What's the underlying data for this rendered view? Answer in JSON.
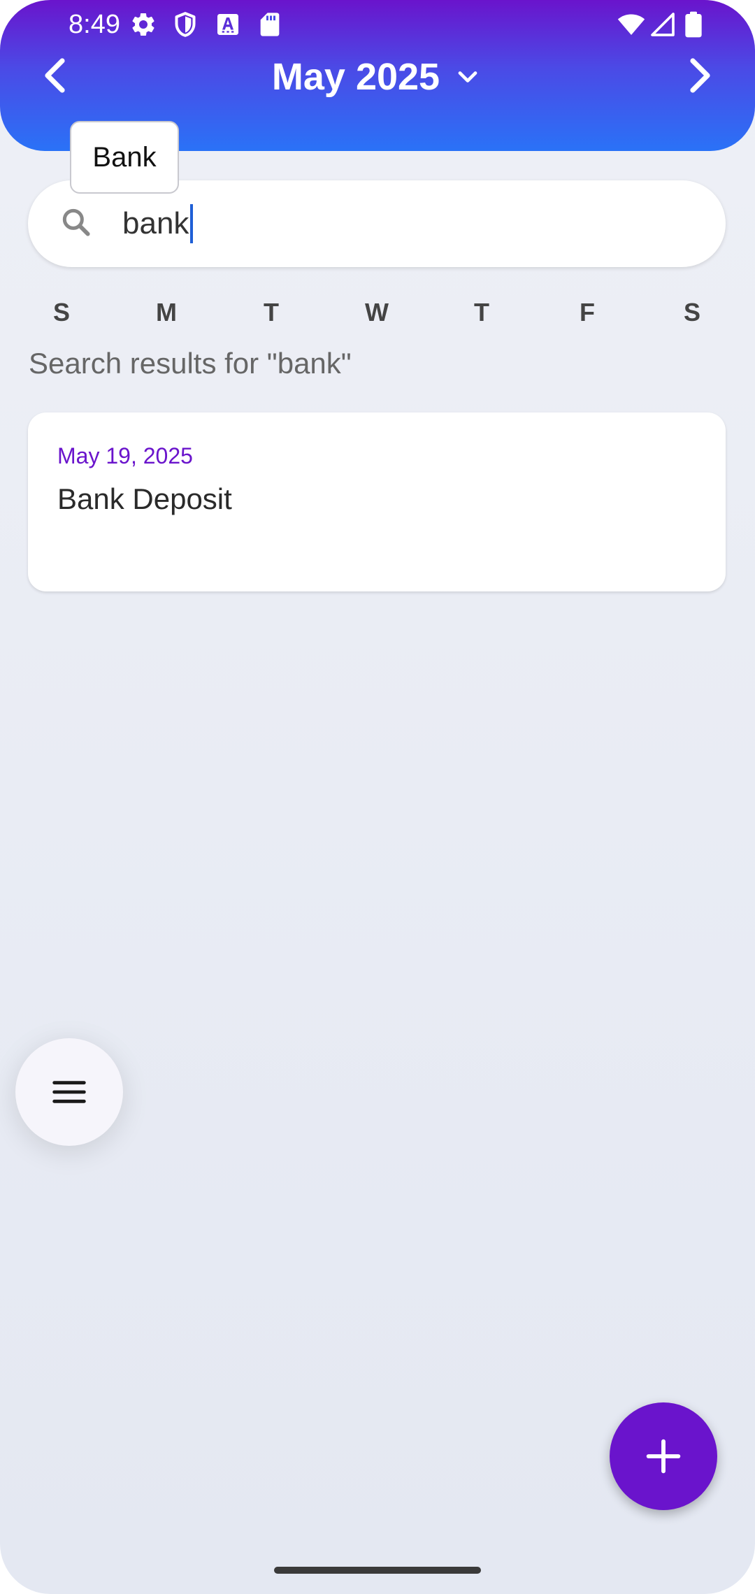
{
  "status_bar": {
    "time": "8:49",
    "left_icons": [
      "gear-icon",
      "shield-icon",
      "a-notification-icon",
      "sd-card-icon"
    ],
    "right_icons": [
      "wifi-icon",
      "cell-signal-icon",
      "battery-icon"
    ]
  },
  "header": {
    "month_label": "May 2025",
    "prev_icon": "chevron-left-icon",
    "next_icon": "chevron-right-icon",
    "dropdown_icon": "chevron-down-icon"
  },
  "suggestion": {
    "label": "Bank"
  },
  "search": {
    "value": "bank",
    "icon": "search-icon"
  },
  "weekdays": [
    "S",
    "M",
    "T",
    "W",
    "T",
    "F",
    "S"
  ],
  "results": {
    "label": "Search results for \"bank\"",
    "items": [
      {
        "date": "May 19, 2025",
        "title": "Bank Deposit"
      }
    ]
  },
  "fabs": {
    "menu_icon": "menu-icon",
    "add_icon": "plus-icon"
  },
  "colors": {
    "accent": "#6a14cc",
    "header_gradient_start": "#6a14cc",
    "header_gradient_end": "#2a72f7",
    "caret": "#1f5fd6"
  }
}
